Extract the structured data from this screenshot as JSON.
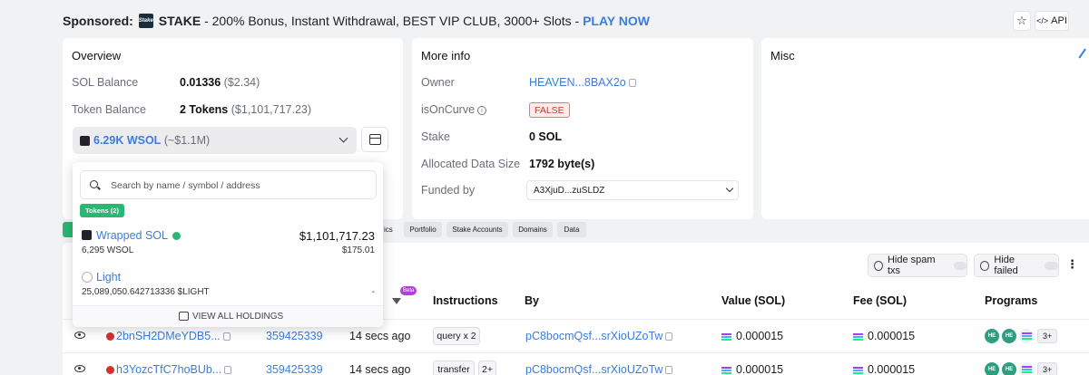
{
  "sponsor": {
    "label": "Sponsored:",
    "logo_text": "Stake",
    "brand": "STAKE",
    "text": " - 200% Bonus, Instant Withdrawal, BEST VIP CLUB, 3000+ Slots - ",
    "cta": "PLAY NOW"
  },
  "top_actions": {
    "api_label": "API"
  },
  "overview": {
    "title": "Overview",
    "sol_balance_label": "SOL Balance",
    "sol_balance_value": "0.01336",
    "sol_balance_usd": "($2.34)",
    "token_balance_label": "Token Balance",
    "token_balance_value": "2 Tokens",
    "token_balance_usd": "($1,101,717.23)",
    "selected_token": "6.29K WSOL",
    "selected_token_usd": "(~$1.1M)"
  },
  "more_info": {
    "title": "More info",
    "owner_label": "Owner",
    "owner_value": "HEAVEN...8BAX2o",
    "oncurve_label": "isOnCurve",
    "oncurve_value": "FALSE",
    "stake_label": "Stake",
    "stake_value": "0 SOL",
    "data_size_label": "Allocated Data Size",
    "data_size_value": "1792 byte(s)",
    "funded_label": "Funded by",
    "funded_value": "A3XjuD...zuSLDZ"
  },
  "misc": {
    "title": "Misc"
  },
  "tabs": [
    "Portfolio",
    "Stake Accounts",
    "Domains",
    "Data"
  ],
  "tab_partial": "ics",
  "token_popup": {
    "search_placeholder": "Search by name / symbol / address",
    "tab_label": "Tokens (2)",
    "tokens": [
      {
        "name": "Wrapped SOL",
        "amount": "6,295 WSOL",
        "value": "$1,101,717.23",
        "price": "$175.01"
      },
      {
        "name": "Light",
        "amount": "25,089,050.642713336 $LIGHT",
        "value": "",
        "price": "-"
      }
    ],
    "footer": "VIEW ALL HOLDINGS"
  },
  "filters": {
    "hide_spam": "Hide spam txs",
    "hide_failed": "Hide failed"
  },
  "beta_label": "Beta",
  "table": {
    "headers": {
      "instructions": "Instructions",
      "by": "By",
      "value": "Value (SOL)",
      "fee": "Fee (SOL)",
      "programs": "Programs"
    },
    "rows": [
      {
        "sig": "2bnSH2DMeYDB5...",
        "block": "359425339",
        "time": "14 secs ago",
        "instr": "query x 2",
        "instr_extra": "",
        "by": "pC8bocmQsf...srXioUZoTw",
        "value": "0.000015",
        "fee": "0.000015",
        "more": "3+"
      },
      {
        "sig": "h3YozcTfC7hoBUb...",
        "block": "359425339",
        "time": "14 secs ago",
        "instr": "transfer",
        "instr_extra": "2+",
        "by": "pC8bocmQsf...srXioUZoTw",
        "value": "0.000015",
        "fee": "0.000015",
        "more": "3+"
      }
    ],
    "program_badges": [
      "HE",
      "HE"
    ]
  }
}
